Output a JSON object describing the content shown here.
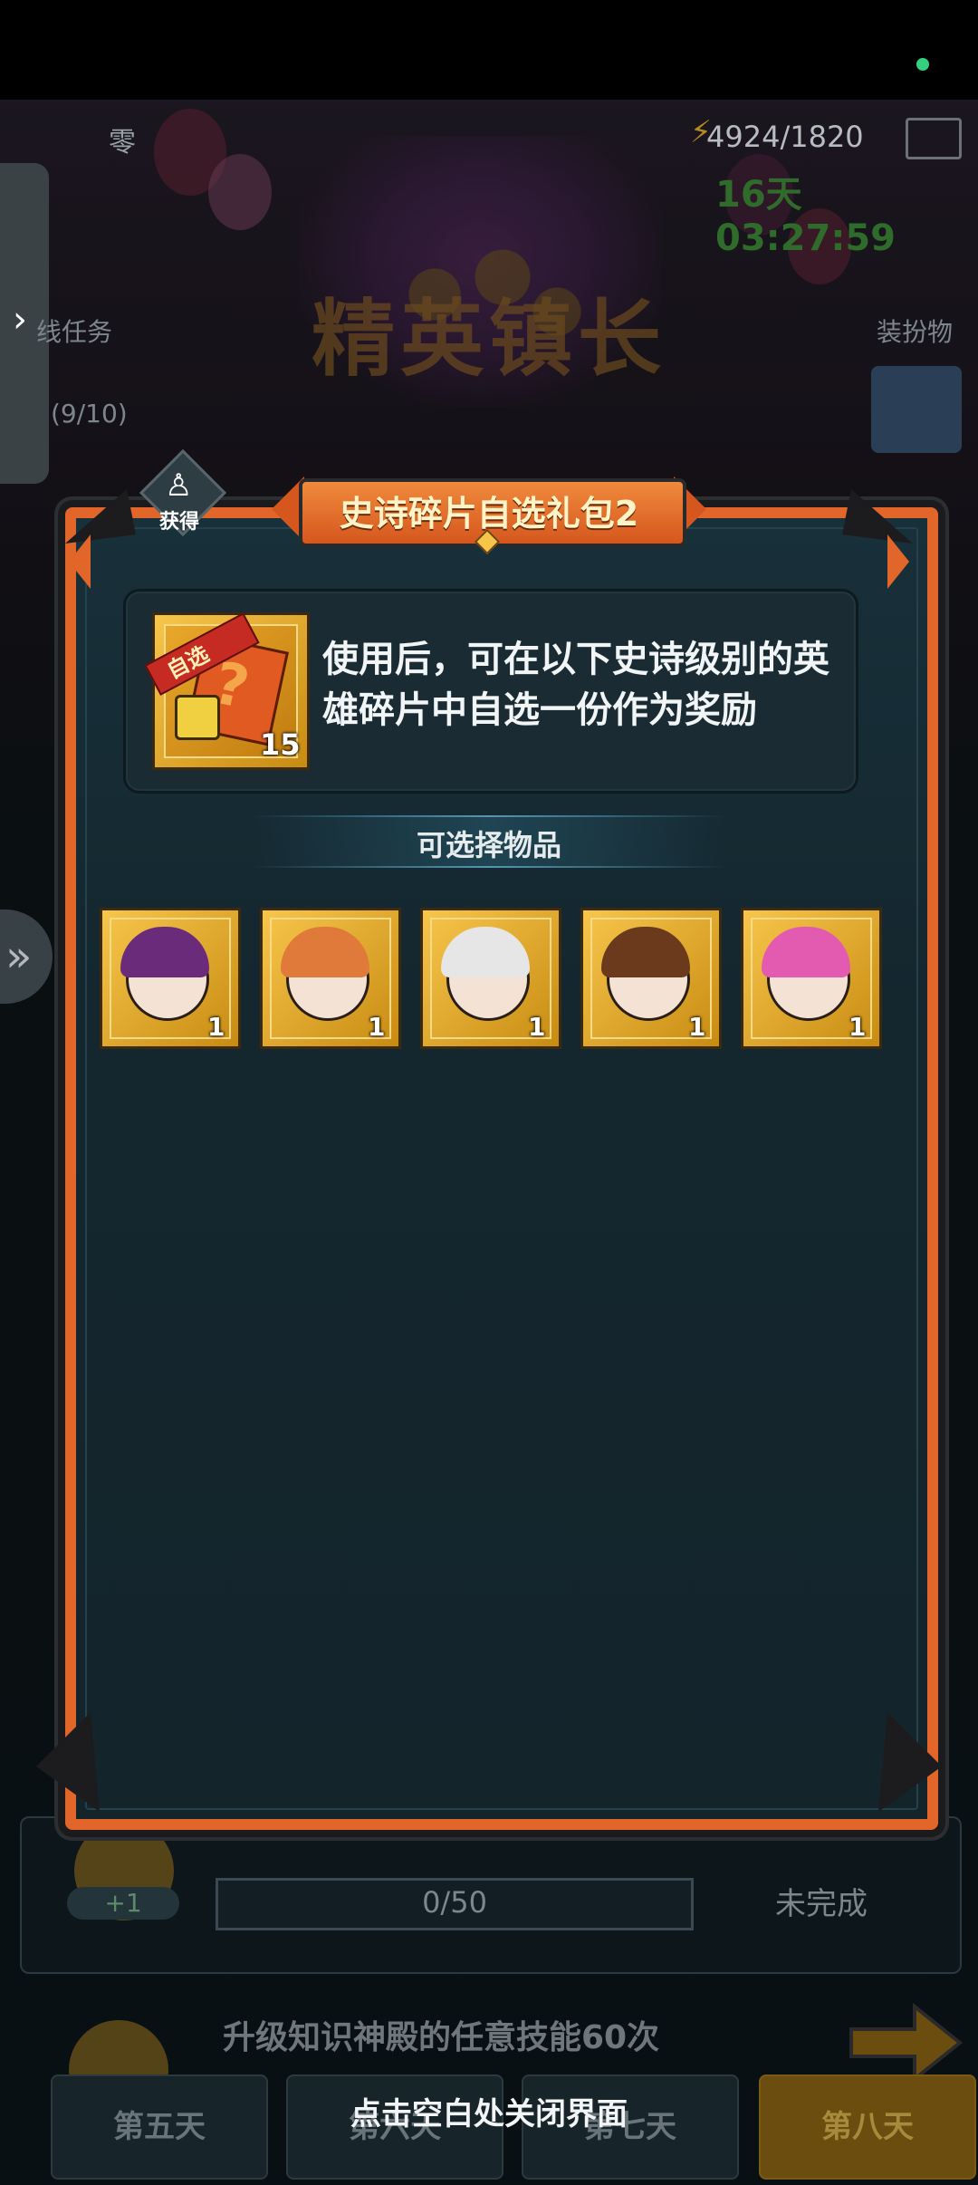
{
  "background": {
    "username": "零",
    "energy": "4924/1820",
    "timer": "16天03:27:59",
    "event_title": "精英镇长",
    "left_task_label": "线任务",
    "left_task_progress": "(9/10)",
    "right_label": "装扮物",
    "task1": {
      "plus": "+1",
      "progress": "0/50",
      "status": "未完成"
    },
    "task2": {
      "text": "升级知识神殿的任意技能60次"
    },
    "days": [
      "第五天",
      "第六天",
      "第七天",
      "第八天"
    ]
  },
  "modal": {
    "obtain_label": "获得",
    "title": "史诗碎片自选礼包2",
    "item": {
      "ribbon": "自选",
      "count": "15",
      "icon": "epic-fragment-card-icon"
    },
    "description": "使用后，可在以下史诗级别的英雄碎片中自选一份作为奖励",
    "section_label": "可选择物品",
    "heroes": [
      {
        "name": "purple-hair-hero-fragment",
        "count": "1",
        "hair": "#6a2b7a"
      },
      {
        "name": "orange-hair-hero-fragment",
        "count": "1",
        "hair": "#e07a3a"
      },
      {
        "name": "old-man-hero-fragment",
        "count": "1",
        "hair": "#e6e6e6"
      },
      {
        "name": "brown-hair-hero-fragment",
        "count": "1",
        "hair": "#6b3a1c"
      },
      {
        "name": "pink-hair-hero-fragment",
        "count": "1",
        "hair": "#e35bb0"
      }
    ]
  },
  "close_hint": "点击空白处关闭界面",
  "colors": {
    "frame": "#e2662a",
    "panel": "#14262e",
    "gold": "#f7c64b",
    "timer": "#2f6b2a"
  }
}
